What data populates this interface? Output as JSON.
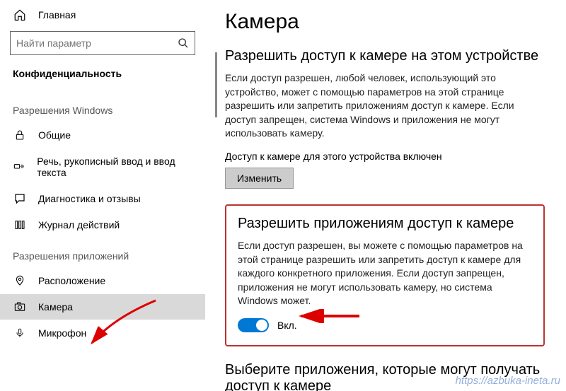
{
  "sidebar": {
    "home": "Главная",
    "search_placeholder": "Найти параметр",
    "section": "Конфиденциальность",
    "group_windows": "Разрешения Windows",
    "group_apps": "Разрешения приложений",
    "items_windows": [
      {
        "label": "Общие"
      },
      {
        "label": "Речь, рукописный ввод и ввод текста"
      },
      {
        "label": "Диагностика и отзывы"
      },
      {
        "label": "Журнал действий"
      }
    ],
    "items_apps": [
      {
        "label": "Расположение"
      },
      {
        "label": "Камера"
      },
      {
        "label": "Микрофон"
      }
    ]
  },
  "main": {
    "title": "Камера",
    "section1": {
      "heading": "Разрешить доступ к камере на этом устройстве",
      "body": "Если доступ разрешен, любой человек, использующий это устройство, может с помощью параметров на этой странице разрешить или запретить приложениям доступ к камере. Если доступ запрещен, система Windows и приложения не могут использовать камеру.",
      "status": "Доступ к камере для этого устройства включен",
      "button": "Изменить"
    },
    "section2": {
      "heading": "Разрешить приложениям доступ к камере",
      "body": "Если доступ разрешен, вы можете с помощью параметров на этой странице разрешить или запретить доступ к камере для каждого конкретного приложения. Если доступ запрещен, приложения не могут использовать камеру, но система Windows может.",
      "toggle_label": "Вкл."
    },
    "section3": {
      "heading": "Выберите приложения, которые могут получать доступ к камере"
    }
  },
  "watermark": "https://azbuka-ineta.ru"
}
